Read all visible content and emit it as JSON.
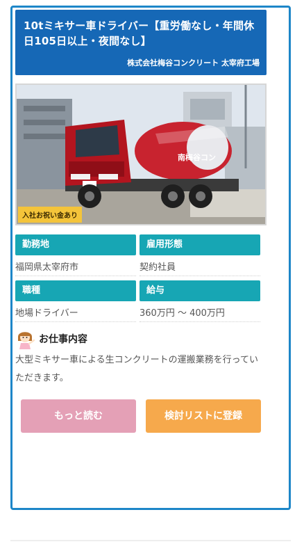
{
  "job": {
    "title": "10tミキサー車ドライバー【重労働なし・年間休日105日以上・夜間なし】",
    "company": "株式会社梅谷コンクリート 太宰府工場",
    "photo_badge": "入社お祝い金あり",
    "truck_logo_text": "南梅谷コン"
  },
  "fields": {
    "location_label": "勤務地",
    "location_value": "福岡県太宰府市",
    "employment_label": "雇用形態",
    "employment_value": "契約社員",
    "category_label": "職種",
    "category_value": "地場ドライバー",
    "salary_label": "給与",
    "salary_value": "360万円 〜 400万円"
  },
  "description": {
    "heading": "お仕事内容",
    "icon": "woman-pointing-icon",
    "text": "大型ミキサー車による生コンクリートの運搬業務を行っていただきます。"
  },
  "buttons": {
    "more_label": "もっと読む",
    "add_label": "検討リストに登録"
  },
  "colors": {
    "card_border": "#1d86c8",
    "header_bg": "#1668b6",
    "label_bg": "#17a6b4",
    "more_button": "#e4a0b6",
    "add_button": "#f6a94c",
    "badge": "#f4c43a"
  }
}
